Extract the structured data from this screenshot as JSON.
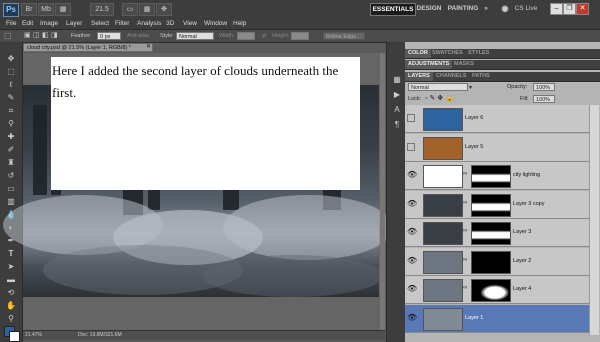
{
  "titlebar": {
    "logo": "Ps",
    "icons": [
      "Br",
      "Mb",
      "21.5",
      "▭",
      "▦",
      "✥"
    ],
    "workspaces": [
      "ESSENTIALS",
      "DESIGN",
      "PAINTING",
      "»"
    ],
    "cs_live": "CS Live",
    "window_buttons": [
      "–",
      "❐",
      "✕"
    ]
  },
  "menu": [
    "File",
    "Edit",
    "Image",
    "Layer",
    "Select",
    "Filter",
    "Analysis",
    "3D",
    "View",
    "Window",
    "Help"
  ],
  "options": {
    "feather_label": "Feather:",
    "feather_value": "0 px",
    "antialias_label": "Anti-alias",
    "style_label": "Style:",
    "style_value": "Normal",
    "width_label": "Width:",
    "height_label": "Height:",
    "refine_edge": "Refine Edge..."
  },
  "document": {
    "tab_title": "cloud city.psd @ 21.5% (Layer 1, RGB/8) *",
    "note_text": "Here I added the second layer of clouds underneath the first.",
    "zoom": "21.47%",
    "doc_info": "Doc: 19.8M/321.6M"
  },
  "panels": {
    "top_tabs": [
      "COLOR",
      "SWATCHES",
      "STYLES"
    ],
    "mid_tabs": [
      "ADJUSTMENTS",
      "MASKS"
    ],
    "layer_tabs": [
      "LAYERS",
      "CHANNELS",
      "PATHS"
    ],
    "blend_mode": "Normal",
    "opacity_label": "Opacity:",
    "opacity_value": "100%",
    "lock_label": "Lock:",
    "fill_label": "Fill:",
    "fill_value": "100%",
    "layers": [
      {
        "name": "Layer 6",
        "thumb_color": "#2d64a0"
      },
      {
        "name": "Layer 5",
        "thumb_color": "#a2632a"
      },
      {
        "name": "city lighting",
        "thumb_color": "#ffffff"
      },
      {
        "name": "Layer 3 copy",
        "thumb_color": "#3a3f46"
      },
      {
        "name": "Layer 3",
        "thumb_color": "#3a3f46"
      },
      {
        "name": "Layer 2",
        "thumb_color": "#6d7680"
      },
      {
        "name": "Layer 4",
        "thumb_color": "#6d7680"
      },
      {
        "name": "Layer 1",
        "thumb_color": "#808a94"
      }
    ]
  },
  "colors": {
    "foreground": "#2d64a0",
    "background": "#ffffff",
    "selected_layer": "#5878b6"
  }
}
